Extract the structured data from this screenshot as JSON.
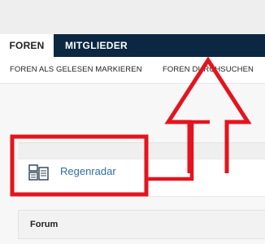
{
  "nav": {
    "tabs": [
      {
        "label": "FOREN"
      },
      {
        "label": "MITGLIEDER"
      }
    ]
  },
  "subnav": {
    "links": [
      {
        "label": "FOREN ALS GELESEN MARKIEREN"
      },
      {
        "label": "FOREN DURCHSUCHEN"
      }
    ]
  },
  "forum": {
    "link_label": "Regenradar",
    "icon": "forum-docs-icon",
    "column_header": "Forum"
  },
  "annotation": {
    "color": "#e4141e"
  }
}
